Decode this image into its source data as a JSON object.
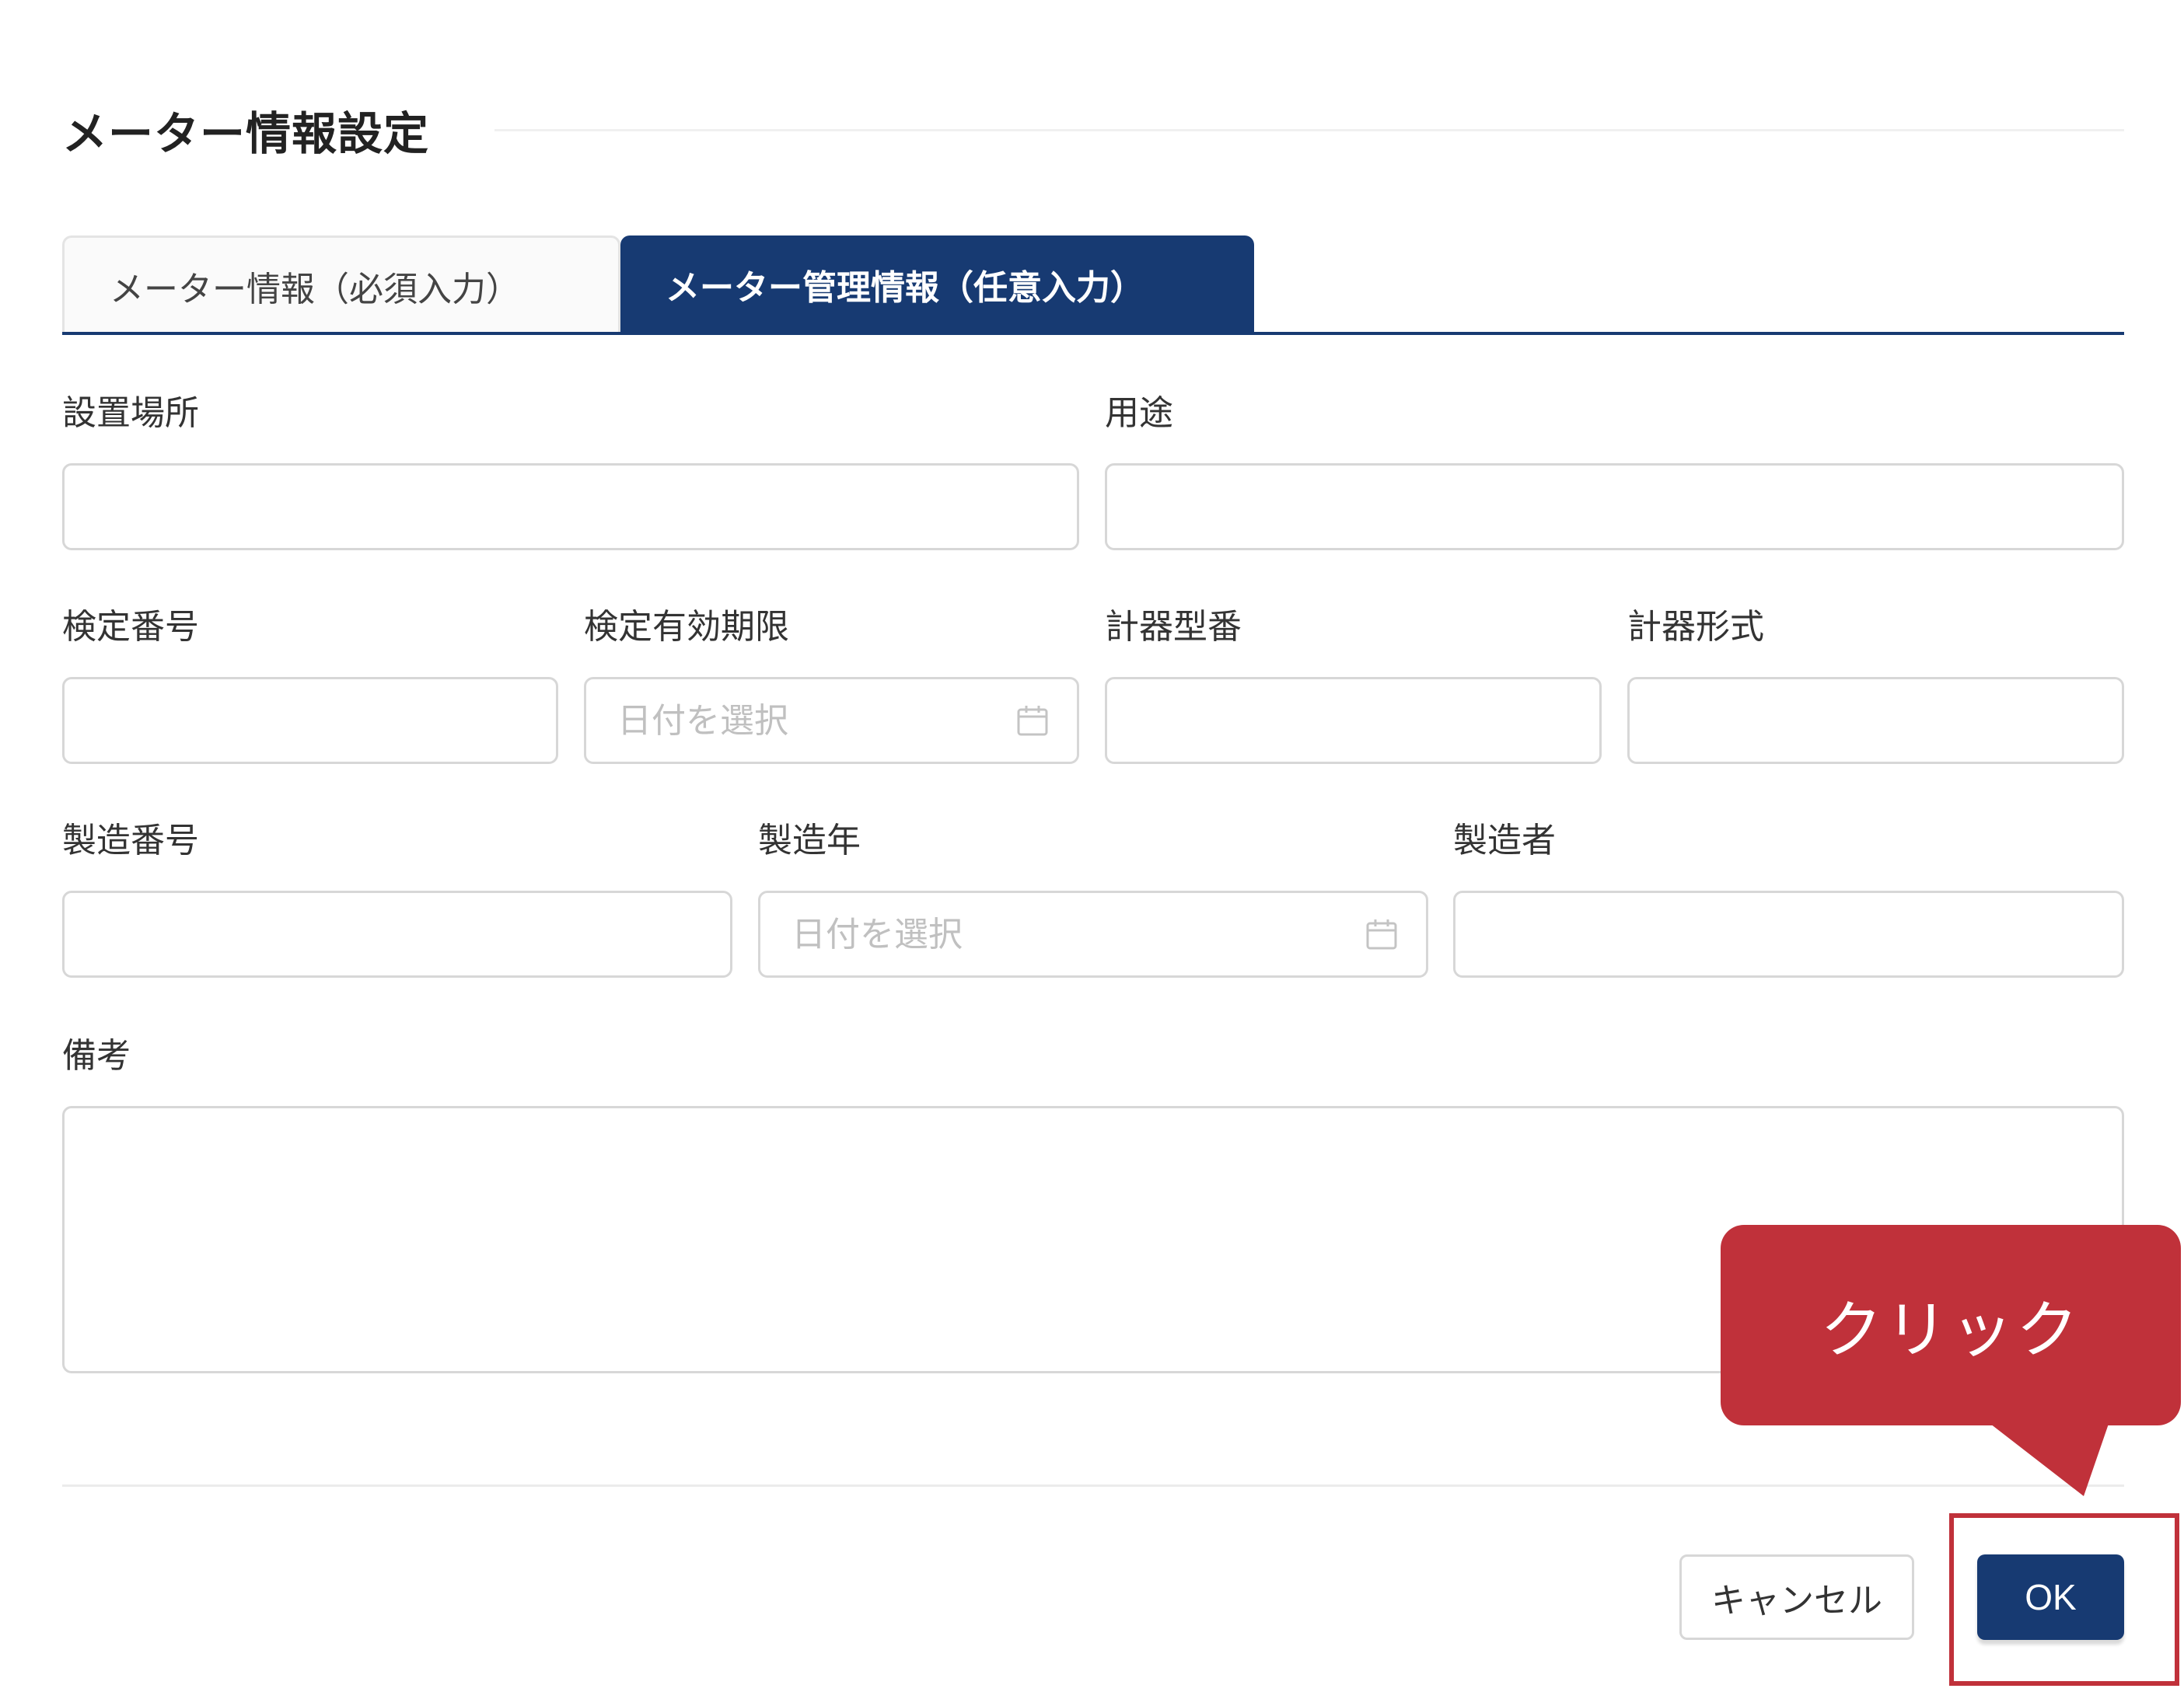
{
  "dialog": {
    "title": "メーター情報設定",
    "tabs": [
      {
        "label": "メーター情報（必須入力）",
        "active": false
      },
      {
        "label": "メーター管理情報（任意入力）",
        "active": true
      }
    ]
  },
  "fields": {
    "installation_location": {
      "label": "設置場所",
      "value": ""
    },
    "usage": {
      "label": "用途",
      "value": ""
    },
    "inspection_number": {
      "label": "検定番号",
      "value": ""
    },
    "inspection_expiry": {
      "label": "検定有効期限",
      "placeholder": "日付を選択"
    },
    "meter_model_number": {
      "label": "計器型番",
      "value": ""
    },
    "meter_type": {
      "label": "計器形式",
      "value": ""
    },
    "serial_number": {
      "label": "製造番号",
      "value": ""
    },
    "manufacture_year": {
      "label": "製造年",
      "placeholder": "日付を選択"
    },
    "manufacturer": {
      "label": "製造者",
      "value": ""
    },
    "remarks": {
      "label": "備考",
      "value": ""
    }
  },
  "footer": {
    "cancel_label": "キャンセル",
    "ok_label": "OK"
  },
  "annotation": {
    "callout_text": "クリック",
    "color": "#c0313a"
  },
  "colors": {
    "primary": "#173a72",
    "border": "#d7d7d7"
  },
  "icons": {
    "date_picker": "calendar-icon"
  }
}
